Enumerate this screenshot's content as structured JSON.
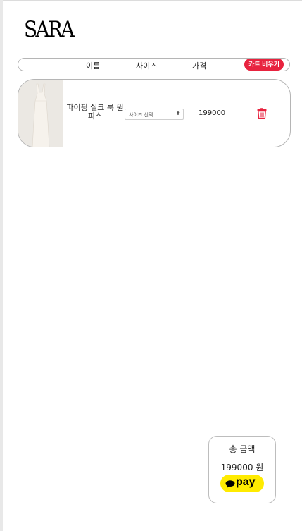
{
  "brand": {
    "logo_text": "SARA"
  },
  "cart_header": {
    "columns": [
      "이름",
      "사이즈",
      "가격"
    ],
    "clear_button": "카트 비우기"
  },
  "items": [
    {
      "name": "파이핑 실크 룩 원피스",
      "size_placeholder": "사이즈 선택",
      "price": "199000",
      "icon": "trash-icon"
    }
  ],
  "summary": {
    "total_label": "총 금액",
    "total_amount": "199000 원",
    "pay_label": "pay",
    "pay_color": "#ffeb00"
  },
  "colors": {
    "accent": "#e8233f",
    "border": "#b5b5b5"
  }
}
